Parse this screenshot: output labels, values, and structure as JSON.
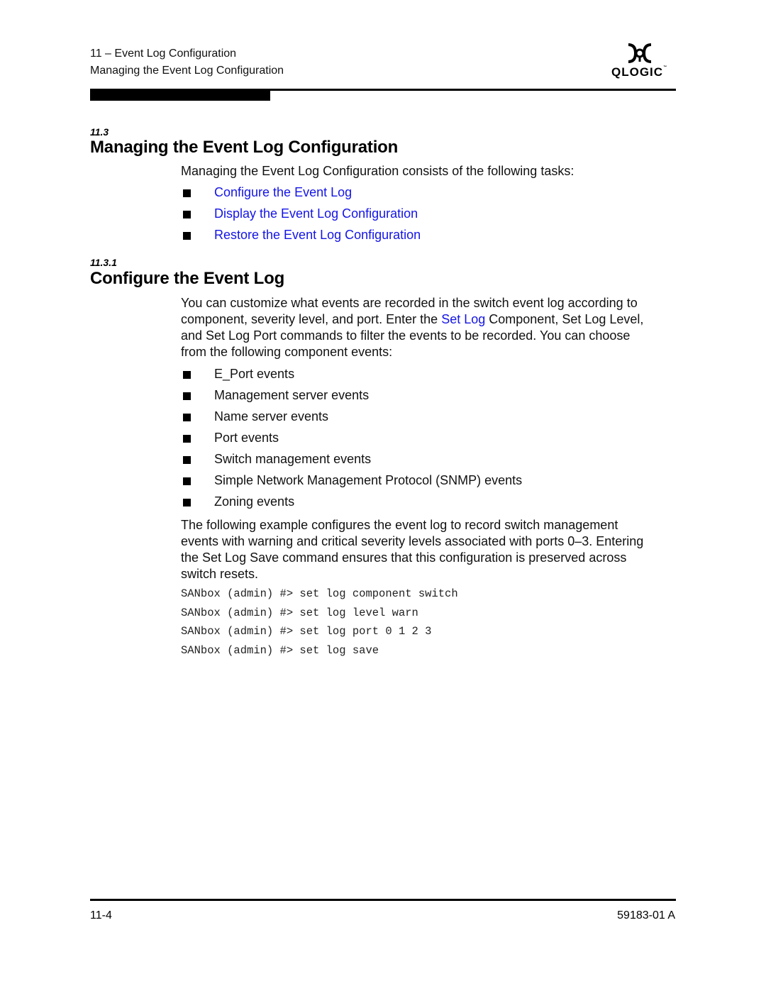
{
  "header": {
    "chapter": "11 – Event Log Configuration",
    "section": "Managing the Event Log Configuration",
    "logo_text": "QLOGIC",
    "logo_tm": "™",
    "logo_icon": "qlogic-logo-icon"
  },
  "section_11_3": {
    "number": "11.3",
    "title": "Managing the Event Log Configuration",
    "intro": "Managing the Event Log Configuration consists of the following tasks:",
    "tasks": [
      "Configure the Event Log",
      "Display the Event Log Configuration",
      "Restore the Event Log Configuration"
    ]
  },
  "section_11_3_1": {
    "number": "11.3.1",
    "title": "Configure the Event Log",
    "para1": {
      "line1": "You can customize what events are recorded in the switch event log according to",
      "line2_before": "component, severity level, and port. Enter the ",
      "line2_link": "Set Log",
      "line2_after": " Component, Set Log Level,",
      "line3": "and Set Log Port commands to filter the events to be recorded. You can choose",
      "line4": "from the following component events:"
    },
    "events": [
      "E_Port events",
      "Management server events",
      "Name server events",
      "Port events",
      "Switch management events",
      "Simple Network Management Protocol (SNMP) events",
      "Zoning events"
    ],
    "para2": [
      "The following example configures the event log to record switch management",
      "events with warning and critical severity levels associated with ports 0–3. Entering",
      "the Set Log Save command ensures that this configuration is preserved across",
      "switch resets."
    ],
    "code": [
      "SANbox (admin) #> set log component switch",
      "SANbox (admin) #> set log level warn",
      "SANbox (admin) #> set log port 0 1 2 3",
      "SANbox (admin) #> set log save"
    ]
  },
  "footer": {
    "page_number": "11-4",
    "doc_id": "59183-01 A"
  },
  "colors": {
    "link": "#1414e6",
    "text": "#000000"
  }
}
